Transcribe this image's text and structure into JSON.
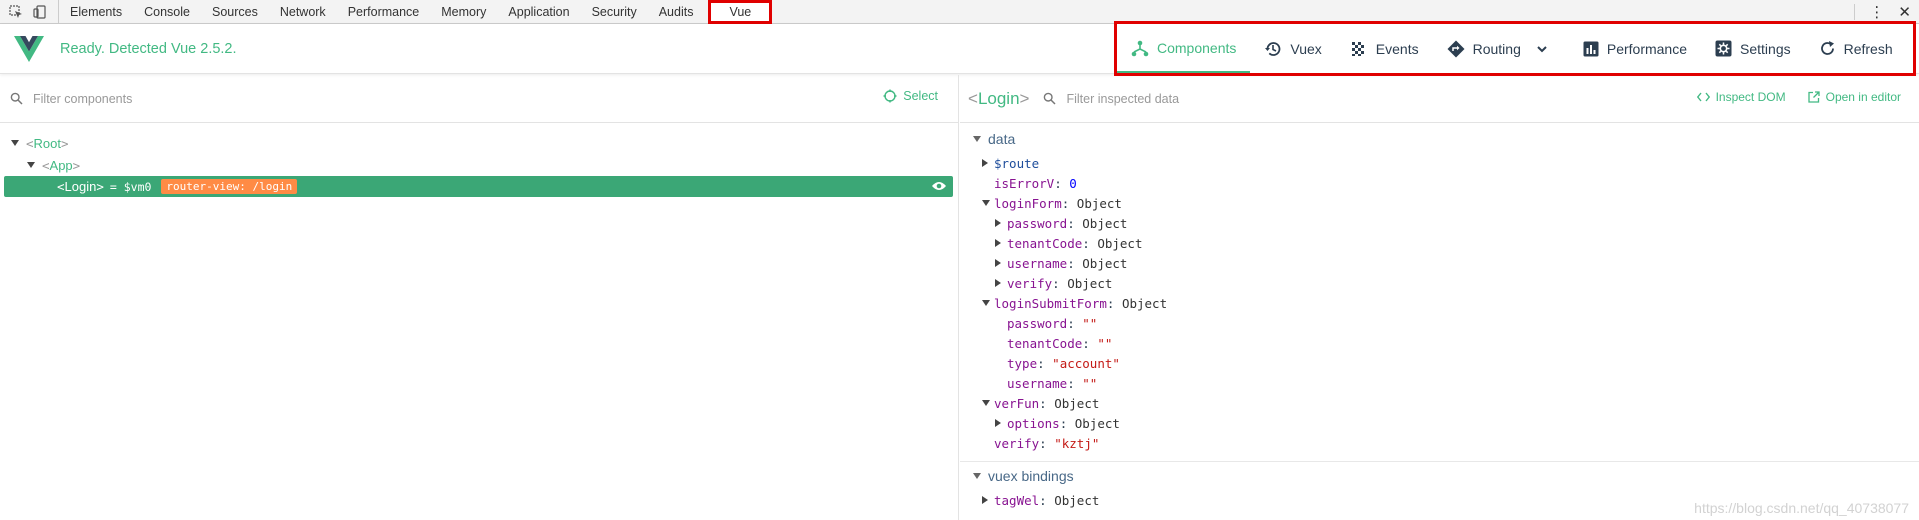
{
  "devtools": {
    "tabs": [
      "Elements",
      "Console",
      "Sources",
      "Network",
      "Performance",
      "Memory",
      "Application",
      "Security",
      "Audits"
    ],
    "active_tab": "Vue"
  },
  "header": {
    "status": "Ready. Detected Vue 2.5.2.",
    "actions": [
      {
        "label": "Components",
        "icon": "components-icon"
      },
      {
        "label": "Vuex",
        "icon": "history-icon"
      },
      {
        "label": "Events",
        "icon": "events-icon"
      },
      {
        "label": "Routing",
        "icon": "routing-icon"
      },
      {
        "label": "Performance",
        "icon": "chart-icon"
      },
      {
        "label": "Settings",
        "icon": "settings-icon"
      },
      {
        "label": "Refresh",
        "icon": "refresh-icon"
      }
    ]
  },
  "left": {
    "filter_placeholder": "Filter components",
    "select_label": "Select",
    "tree": {
      "root": "Root",
      "app": "App",
      "login": "Login",
      "vm": "= $vm0",
      "badge": "router-view: /login"
    }
  },
  "right": {
    "component": "Login",
    "filter_placeholder": "Filter inspected data",
    "inspect_dom": "Inspect DOM",
    "open_editor": "Open in editor",
    "sections": {
      "data_title": "data",
      "vuex_title": "vuex bindings"
    },
    "data_rows": {
      "route_key": "$route",
      "iserror_key": "isErrorV",
      "iserror_val": "0",
      "loginform_key": "loginForm",
      "obj": "Object",
      "password_key": "password",
      "tenantcode_key": "tenantCode",
      "username_key": "username",
      "verify_key": "verify",
      "submitform_key": "loginSubmitForm",
      "empty_str": "\"\"",
      "type_key": "type",
      "type_val": "\"account\"",
      "verfun_key": "verFun",
      "options_key": "options",
      "verify_val": "\"kztj\"",
      "tagwel_key": "tagWel"
    }
  },
  "watermark": "https://blog.csdn.net/qq_40738077"
}
